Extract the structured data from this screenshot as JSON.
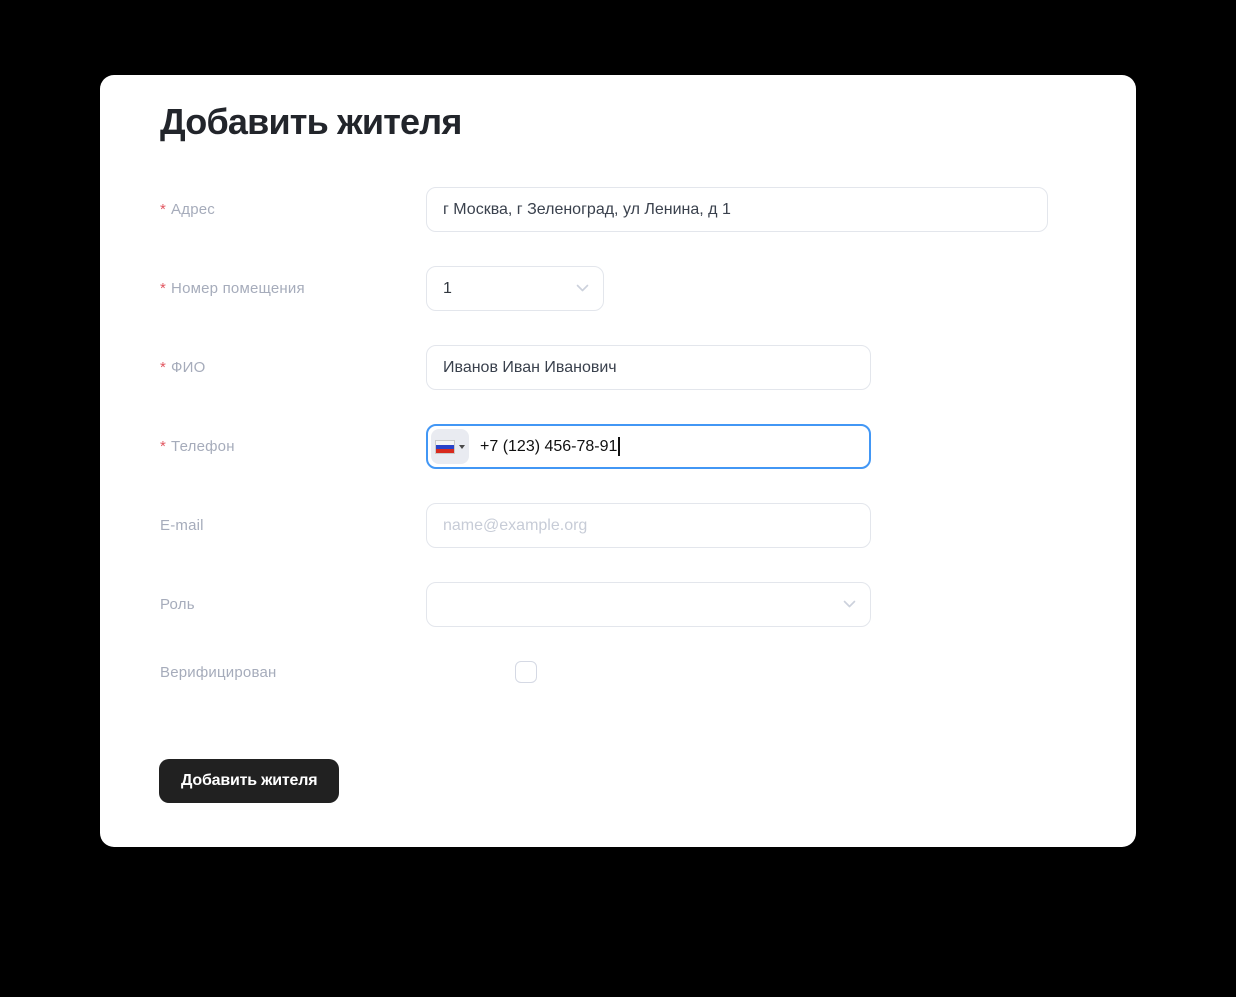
{
  "title": "Добавить жителя",
  "required_marker": "*",
  "fields": {
    "address": {
      "label": "Адрес",
      "required": true,
      "value": "г Москва, г Зеленоград, ул Ленина, д 1"
    },
    "room": {
      "label": "Номер помещения",
      "required": true,
      "value": "1"
    },
    "full_name": {
      "label": "ФИО",
      "required": true,
      "value": "Иванов Иван Иванович"
    },
    "phone": {
      "label": "Телефон",
      "required": true,
      "value": "+7 (123) 456-78-91",
      "flag": "russia-flag"
    },
    "email": {
      "label": "E-mail",
      "required": false,
      "value": "",
      "placeholder": "name@example.org"
    },
    "role": {
      "label": "Роль",
      "required": false,
      "value": ""
    },
    "verified": {
      "label": "Верифицирован",
      "required": false,
      "checked": false
    }
  },
  "submit_button": {
    "label": "Добавить жителя"
  },
  "colors": {
    "page_background": "#000000",
    "card_background": "#ffffff",
    "focus_border": "#4297f5",
    "required_asterisk": "#e25761",
    "label_text": "#a6acbb",
    "button_background": "#212121",
    "button_text": "#ffffff"
  }
}
